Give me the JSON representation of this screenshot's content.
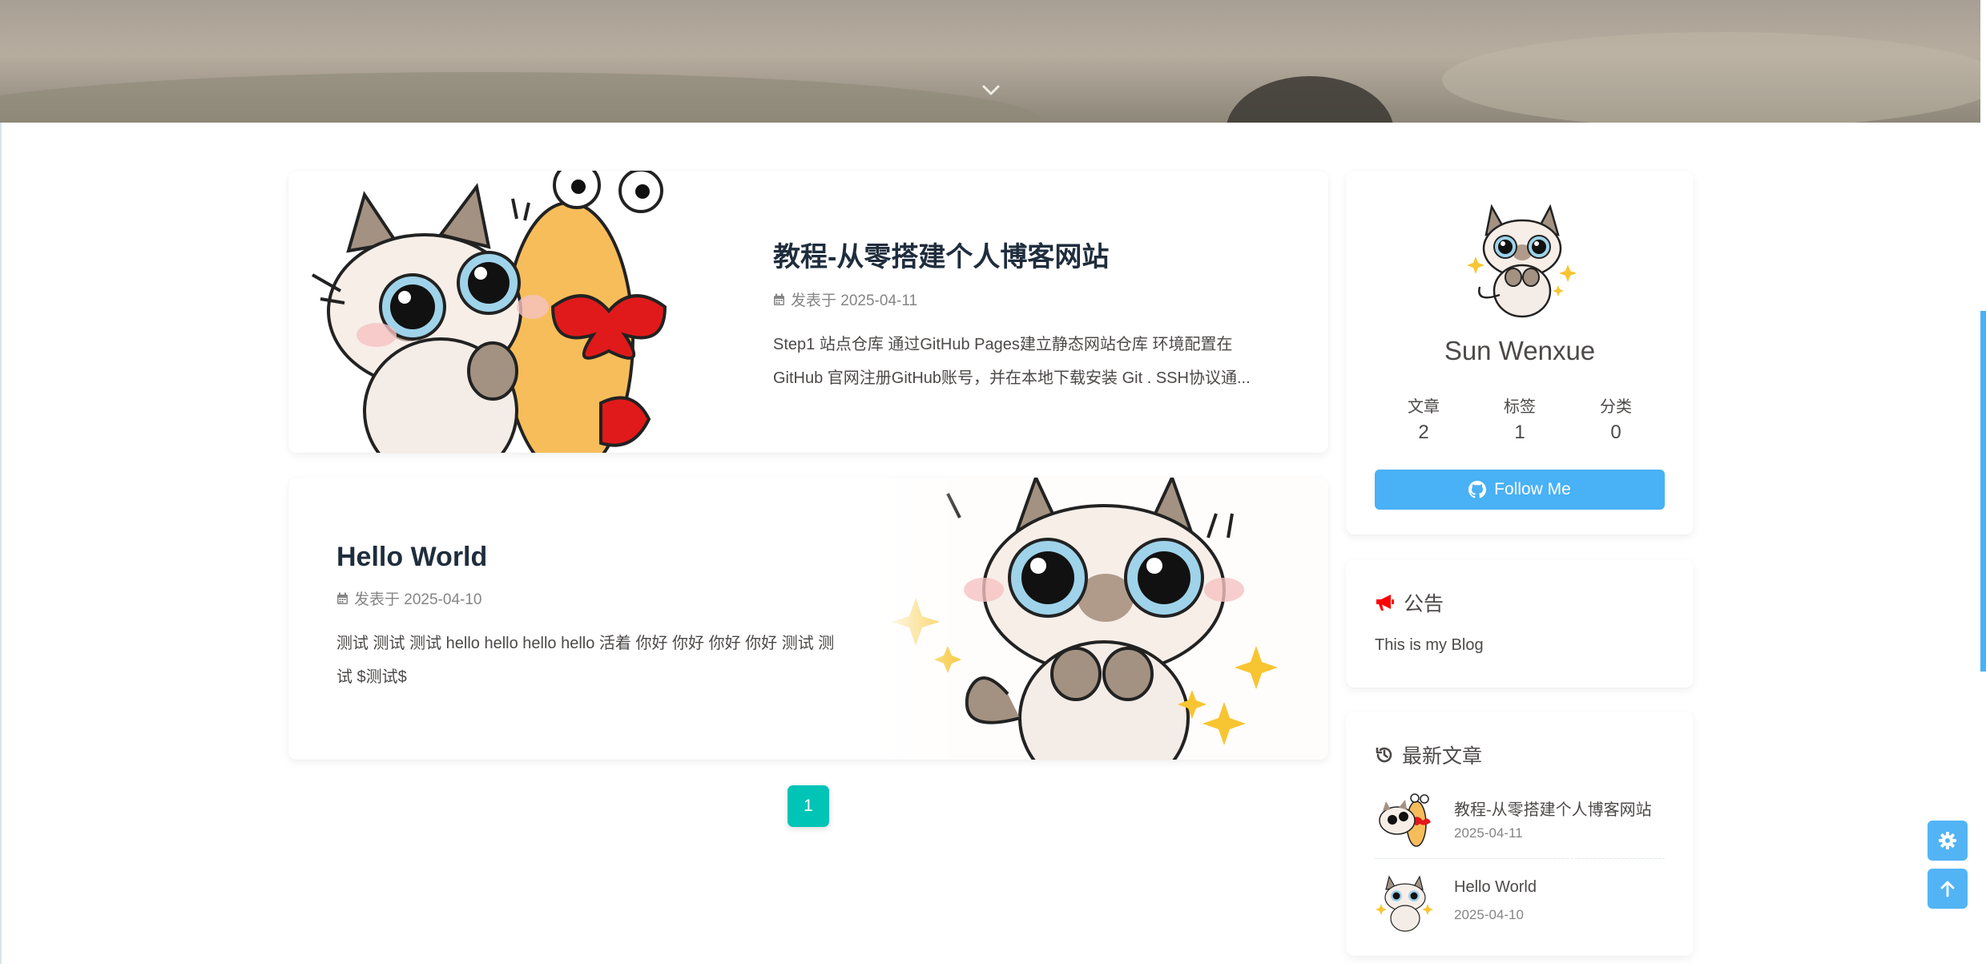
{
  "posts": [
    {
      "title": "教程-从零搭建个人博客网站",
      "meta": "发表于 2025-04-11",
      "excerpt": "Step1 站点仓库 通过GitHub Pages建立静态网站仓库 环境配置在 GitHub 官网注册GitHub账号，并在本地下载安装 Git . SSH协议通..."
    },
    {
      "title": "Hello World",
      "meta": "发表于 2025-04-10",
      "excerpt": "测试 测试 测试 hello hello hello hello 活着 你好 你好 你好 你好 测试 测试 $测试$"
    }
  ],
  "pagination": {
    "current": "1"
  },
  "author": {
    "name": "Sun Wenxue",
    "stats": [
      {
        "label": "文章",
        "value": "2"
      },
      {
        "label": "标签",
        "value": "1"
      },
      {
        "label": "分类",
        "value": "0"
      }
    ],
    "follow_label": "Follow Me"
  },
  "notice": {
    "title": "公告",
    "text": "This is my Blog"
  },
  "recent": {
    "title": "最新文章",
    "items": [
      {
        "title": "教程-从零搭建个人博客网站",
        "date": "2025-04-11"
      },
      {
        "title": "Hello World",
        "date": "2025-04-10"
      }
    ]
  },
  "colors": {
    "accent": "#49b1f5",
    "pager": "#00c4b6",
    "notice_icon": "#ff0000"
  },
  "icons": {
    "hero": "chevron-down-icon",
    "meta": "calendar-icon",
    "follow": "github-icon",
    "notice": "bullhorn-icon",
    "recent": "history-icon",
    "settings": "gear-icon",
    "top": "arrow-up-icon"
  }
}
